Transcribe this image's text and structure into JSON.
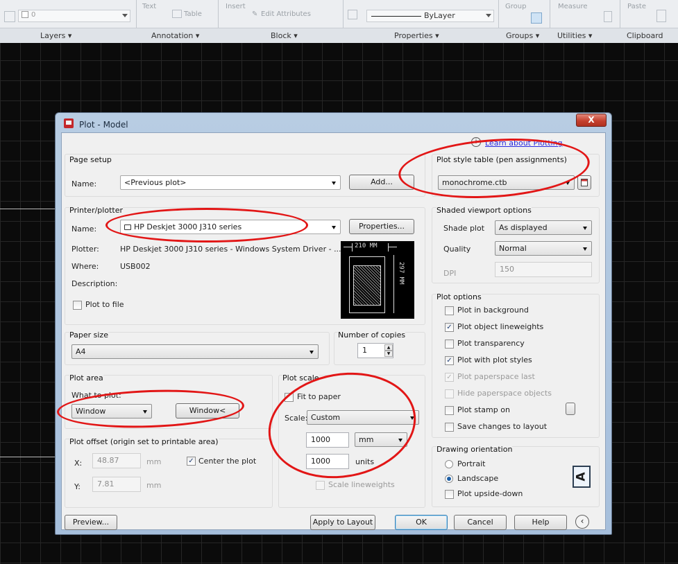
{
  "ribbon": {
    "top_items": {
      "layer_value": "0",
      "text": "Text",
      "table": "Table",
      "insert": "Insert",
      "edit_attributes": "Edit Attributes",
      "bylayer": "ByLayer",
      "group": "Group",
      "measure": "Measure",
      "paste": "Paste"
    },
    "panels": [
      "Layers ▾",
      "Annotation ▾",
      "Block ▾",
      "Properties ▾",
      "Groups ▾",
      "Utilities ▾",
      "Clipboard"
    ]
  },
  "dialog": {
    "title": "Plot - Model",
    "close": "X",
    "learn_link": "Learn about Plotting",
    "page_setup": {
      "label": "Page setup",
      "name_label": "Name:",
      "name_value": "<Previous plot>",
      "add_button": "Add..."
    },
    "printer": {
      "label": "Printer/plotter",
      "name_label": "Name:",
      "name_value": "HP Deskjet 3000 J310 series",
      "properties_button": "Properties...",
      "plotter_label": "Plotter:",
      "plotter_value": "HP Deskjet 3000 J310 series - Windows System Driver - ...",
      "where_label": "Where:",
      "where_value": "USB002",
      "description_label": "Description:",
      "plot_to_file": "Plot to file",
      "preview_width": "210 MM",
      "preview_height": "297 MM"
    },
    "paper_size": {
      "label": "Paper size",
      "value": "A4"
    },
    "copies": {
      "label": "Number of copies",
      "value": "1"
    },
    "plot_area": {
      "label": "Plot area",
      "what_to_plot": "What to plot:",
      "value": "Window",
      "window_button": "Window<"
    },
    "plot_offset": {
      "label": "Plot offset (origin set to printable area)",
      "x_label": "X:",
      "x_value": "48.87",
      "y_label": "Y:",
      "y_value": "7.81",
      "unit": "mm",
      "center": "Center the plot"
    },
    "plot_scale": {
      "label": "Plot scale",
      "fit": "Fit to paper",
      "scale_label": "Scale:",
      "scale_value": "Custom",
      "value1": "1000",
      "unit1": "mm",
      "value2": "1000",
      "unit2": "units",
      "scale_lineweights": "Scale lineweights"
    },
    "plot_style": {
      "label": "Plot style table (pen assignments)",
      "value": "monochrome.ctb"
    },
    "shaded": {
      "label": "Shaded viewport options",
      "shade_label": "Shade plot",
      "shade_value": "As displayed",
      "quality_label": "Quality",
      "quality_value": "Normal",
      "dpi_label": "DPI",
      "dpi_value": "150"
    },
    "plot_options": {
      "label": "Plot options",
      "items": [
        {
          "label": "Plot in background",
          "checked": false,
          "enabled": true
        },
        {
          "label": "Plot object lineweights",
          "checked": true,
          "enabled": true
        },
        {
          "label": "Plot transparency",
          "checked": false,
          "enabled": true
        },
        {
          "label": "Plot with plot styles",
          "checked": true,
          "enabled": true
        },
        {
          "label": "Plot paperspace last",
          "checked": true,
          "enabled": false
        },
        {
          "label": "Hide paperspace objects",
          "checked": false,
          "enabled": false
        },
        {
          "label": "Plot stamp on",
          "checked": false,
          "enabled": true
        },
        {
          "label": "Save changes to layout",
          "checked": false,
          "enabled": true
        }
      ]
    },
    "orientation": {
      "label": "Drawing orientation",
      "portrait": "Portrait",
      "landscape": "Landscape",
      "selected": "Landscape",
      "upside_down": "Plot upside-down",
      "icon_glyph": "A"
    },
    "buttons": {
      "preview": "Preview...",
      "apply": "Apply to Layout",
      "ok": "OK",
      "cancel": "Cancel",
      "help": "Help"
    }
  }
}
